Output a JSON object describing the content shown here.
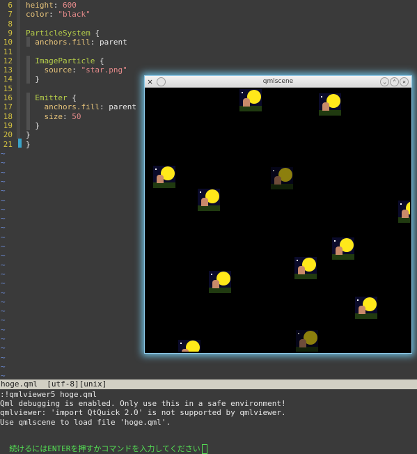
{
  "editor": {
    "lines": [
      {
        "num": "6",
        "parts": [
          {
            "t": "height",
            "c": "kw"
          },
          {
            "t": ": ",
            "c": "plain"
          },
          {
            "t": "600",
            "c": "num"
          }
        ]
      },
      {
        "num": "7",
        "parts": [
          {
            "t": "color",
            "c": "kw"
          },
          {
            "t": ": ",
            "c": "plain"
          },
          {
            "t": "\"black\"",
            "c": "str"
          }
        ]
      },
      {
        "num": "8",
        "parts": []
      },
      {
        "num": "9",
        "parts": [
          {
            "t": "ParticleSystem",
            "c": "ty"
          },
          {
            "t": " {",
            "c": "plain"
          }
        ]
      },
      {
        "num": "10",
        "parts": [
          {
            "t": "  ",
            "c": "plain"
          },
          {
            "t": "anchors.fill",
            "c": "kw"
          },
          {
            "t": ": parent",
            "c": "plain"
          }
        ]
      },
      {
        "num": "11",
        "parts": []
      },
      {
        "num": "12",
        "parts": [
          {
            "t": "  ",
            "c": "plain"
          },
          {
            "t": "ImageParticle",
            "c": "ty"
          },
          {
            "t": " {",
            "c": "plain"
          }
        ]
      },
      {
        "num": "13",
        "parts": [
          {
            "t": "    ",
            "c": "plain"
          },
          {
            "t": "source",
            "c": "kw"
          },
          {
            "t": ": ",
            "c": "plain"
          },
          {
            "t": "\"star.png\"",
            "c": "str"
          }
        ]
      },
      {
        "num": "14",
        "parts": [
          {
            "t": "  }",
            "c": "plain"
          }
        ]
      },
      {
        "num": "15",
        "parts": []
      },
      {
        "num": "16",
        "parts": [
          {
            "t": "  ",
            "c": "plain"
          },
          {
            "t": "Emitter",
            "c": "ty"
          },
          {
            "t": " {",
            "c": "plain"
          }
        ]
      },
      {
        "num": "17",
        "parts": [
          {
            "t": "    ",
            "c": "plain"
          },
          {
            "t": "anchors.fill",
            "c": "kw"
          },
          {
            "t": ": parent",
            "c": "plain"
          }
        ]
      },
      {
        "num": "18",
        "parts": [
          {
            "t": "    ",
            "c": "plain"
          },
          {
            "t": "size",
            "c": "kw"
          },
          {
            "t": ": ",
            "c": "plain"
          },
          {
            "t": "50",
            "c": "num"
          }
        ]
      },
      {
        "num": "19",
        "parts": [
          {
            "t": "  }",
            "c": "plain"
          }
        ]
      },
      {
        "num": "20",
        "parts": [
          {
            "t": "}",
            "c": "plain"
          }
        ]
      },
      {
        "num": "21",
        "parts": [
          {
            "t": "}",
            "c": "plain"
          }
        ]
      }
    ],
    "tilde": "~",
    "tilde_count": 25
  },
  "statusbar": {
    "text": "hoge.qml  [utf-8][unix]"
  },
  "messages": [
    ":!qmlviewer5 hoge.qml",
    "Qml debugging is enabled. Only use this in a safe environment!",
    "qmlviewer: 'import QtQuick 2.0' is not supported by qmlviewer.",
    "Use qmlscene to load file 'hoge.qml'."
  ],
  "prompt": {
    "text": "続けるにはENTERを押すかコマンドを入力してください"
  },
  "window": {
    "title": "qmlscene",
    "close_glyph": "✕",
    "buttons": [
      "⌄",
      "⌃",
      "✕"
    ],
    "particle_count": 12,
    "particles": [
      {
        "img": "star.png",
        "faded": false
      },
      {
        "img": "star.png",
        "faded": false
      },
      {
        "img": "star.png",
        "faded": true
      },
      {
        "img": "star.png",
        "faded": false
      },
      {
        "img": "star.png",
        "faded": false
      },
      {
        "img": "star.png",
        "faded": false
      },
      {
        "img": "star.png",
        "faded": false
      },
      {
        "img": "star.png",
        "faded": false
      },
      {
        "img": "star.png",
        "faded": false
      },
      {
        "img": "star.png",
        "faded": true
      },
      {
        "img": "star.png",
        "faded": false
      },
      {
        "img": "star.png",
        "faded": false
      }
    ]
  },
  "colors": {
    "line_number": "#d6c441",
    "tilde": "#6d8cd8",
    "prompt": "#54e254",
    "window_glow": "#6fbfe0"
  }
}
